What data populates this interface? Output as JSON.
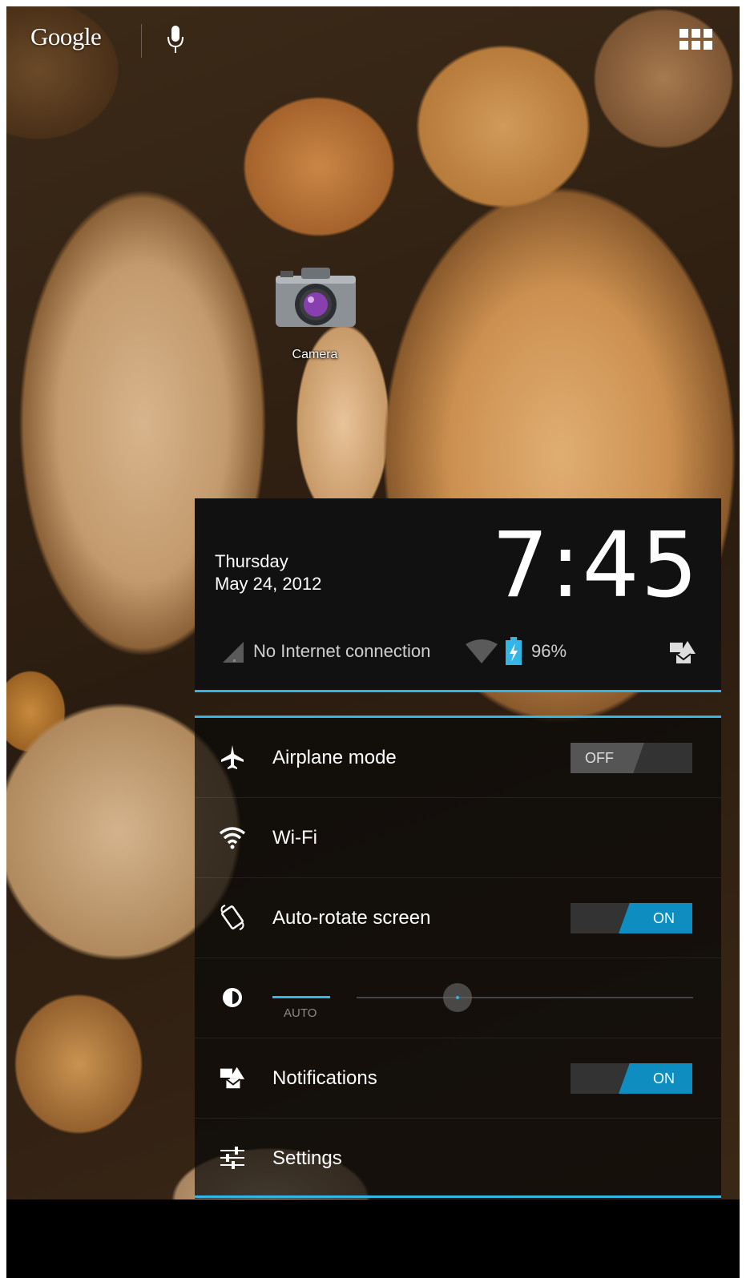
{
  "launcher": {
    "google_label": "Google",
    "camera_label": "Camera"
  },
  "notification_header": {
    "day": "Thursday",
    "date": "May 24, 2012",
    "time": "7:45",
    "connection_status": "No Internet connection",
    "battery_percent": "96%"
  },
  "quick_settings": {
    "airplane": {
      "label": "Airplane mode",
      "toggle": "OFF"
    },
    "wifi": {
      "label": "Wi-Fi"
    },
    "autorotate": {
      "label": "Auto-rotate screen",
      "toggle": "ON"
    },
    "brightness": {
      "auto_label": "AUTO"
    },
    "notifications": {
      "label": "Notifications",
      "toggle": "ON"
    },
    "settings": {
      "label": "Settings"
    }
  },
  "colors": {
    "accent": "#33b5e5",
    "toggle_on": "#0e8ec0",
    "panel_bg": "#111111"
  },
  "icons": [
    "mic-icon",
    "apps-grid-icon",
    "camera-icon",
    "signal-icon",
    "wifi-icon",
    "battery-charging-icon",
    "notification-icon",
    "airplane-icon",
    "auto-rotate-icon",
    "brightness-icon",
    "settings-sliders-icon"
  ]
}
